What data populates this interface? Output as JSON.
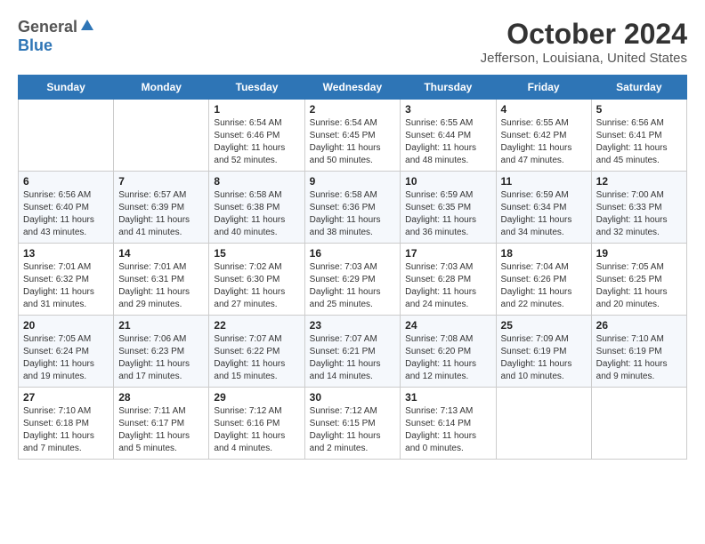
{
  "logo": {
    "general": "General",
    "blue": "Blue"
  },
  "title": "October 2024",
  "subtitle": "Jefferson, Louisiana, United States",
  "days_header": [
    "Sunday",
    "Monday",
    "Tuesday",
    "Wednesday",
    "Thursday",
    "Friday",
    "Saturday"
  ],
  "weeks": [
    [
      {
        "day": "",
        "info": ""
      },
      {
        "day": "",
        "info": ""
      },
      {
        "day": "1",
        "info": "Sunrise: 6:54 AM\nSunset: 6:46 PM\nDaylight: 11 hours and 52 minutes."
      },
      {
        "day": "2",
        "info": "Sunrise: 6:54 AM\nSunset: 6:45 PM\nDaylight: 11 hours and 50 minutes."
      },
      {
        "day": "3",
        "info": "Sunrise: 6:55 AM\nSunset: 6:44 PM\nDaylight: 11 hours and 48 minutes."
      },
      {
        "day": "4",
        "info": "Sunrise: 6:55 AM\nSunset: 6:42 PM\nDaylight: 11 hours and 47 minutes."
      },
      {
        "day": "5",
        "info": "Sunrise: 6:56 AM\nSunset: 6:41 PM\nDaylight: 11 hours and 45 minutes."
      }
    ],
    [
      {
        "day": "6",
        "info": "Sunrise: 6:56 AM\nSunset: 6:40 PM\nDaylight: 11 hours and 43 minutes."
      },
      {
        "day": "7",
        "info": "Sunrise: 6:57 AM\nSunset: 6:39 PM\nDaylight: 11 hours and 41 minutes."
      },
      {
        "day": "8",
        "info": "Sunrise: 6:58 AM\nSunset: 6:38 PM\nDaylight: 11 hours and 40 minutes."
      },
      {
        "day": "9",
        "info": "Sunrise: 6:58 AM\nSunset: 6:36 PM\nDaylight: 11 hours and 38 minutes."
      },
      {
        "day": "10",
        "info": "Sunrise: 6:59 AM\nSunset: 6:35 PM\nDaylight: 11 hours and 36 minutes."
      },
      {
        "day": "11",
        "info": "Sunrise: 6:59 AM\nSunset: 6:34 PM\nDaylight: 11 hours and 34 minutes."
      },
      {
        "day": "12",
        "info": "Sunrise: 7:00 AM\nSunset: 6:33 PM\nDaylight: 11 hours and 32 minutes."
      }
    ],
    [
      {
        "day": "13",
        "info": "Sunrise: 7:01 AM\nSunset: 6:32 PM\nDaylight: 11 hours and 31 minutes."
      },
      {
        "day": "14",
        "info": "Sunrise: 7:01 AM\nSunset: 6:31 PM\nDaylight: 11 hours and 29 minutes."
      },
      {
        "day": "15",
        "info": "Sunrise: 7:02 AM\nSunset: 6:30 PM\nDaylight: 11 hours and 27 minutes."
      },
      {
        "day": "16",
        "info": "Sunrise: 7:03 AM\nSunset: 6:29 PM\nDaylight: 11 hours and 25 minutes."
      },
      {
        "day": "17",
        "info": "Sunrise: 7:03 AM\nSunset: 6:28 PM\nDaylight: 11 hours and 24 minutes."
      },
      {
        "day": "18",
        "info": "Sunrise: 7:04 AM\nSunset: 6:26 PM\nDaylight: 11 hours and 22 minutes."
      },
      {
        "day": "19",
        "info": "Sunrise: 7:05 AM\nSunset: 6:25 PM\nDaylight: 11 hours and 20 minutes."
      }
    ],
    [
      {
        "day": "20",
        "info": "Sunrise: 7:05 AM\nSunset: 6:24 PM\nDaylight: 11 hours and 19 minutes."
      },
      {
        "day": "21",
        "info": "Sunrise: 7:06 AM\nSunset: 6:23 PM\nDaylight: 11 hours and 17 minutes."
      },
      {
        "day": "22",
        "info": "Sunrise: 7:07 AM\nSunset: 6:22 PM\nDaylight: 11 hours and 15 minutes."
      },
      {
        "day": "23",
        "info": "Sunrise: 7:07 AM\nSunset: 6:21 PM\nDaylight: 11 hours and 14 minutes."
      },
      {
        "day": "24",
        "info": "Sunrise: 7:08 AM\nSunset: 6:20 PM\nDaylight: 11 hours and 12 minutes."
      },
      {
        "day": "25",
        "info": "Sunrise: 7:09 AM\nSunset: 6:19 PM\nDaylight: 11 hours and 10 minutes."
      },
      {
        "day": "26",
        "info": "Sunrise: 7:10 AM\nSunset: 6:19 PM\nDaylight: 11 hours and 9 minutes."
      }
    ],
    [
      {
        "day": "27",
        "info": "Sunrise: 7:10 AM\nSunset: 6:18 PM\nDaylight: 11 hours and 7 minutes."
      },
      {
        "day": "28",
        "info": "Sunrise: 7:11 AM\nSunset: 6:17 PM\nDaylight: 11 hours and 5 minutes."
      },
      {
        "day": "29",
        "info": "Sunrise: 7:12 AM\nSunset: 6:16 PM\nDaylight: 11 hours and 4 minutes."
      },
      {
        "day": "30",
        "info": "Sunrise: 7:12 AM\nSunset: 6:15 PM\nDaylight: 11 hours and 2 minutes."
      },
      {
        "day": "31",
        "info": "Sunrise: 7:13 AM\nSunset: 6:14 PM\nDaylight: 11 hours and 0 minutes."
      },
      {
        "day": "",
        "info": ""
      },
      {
        "day": "",
        "info": ""
      }
    ]
  ]
}
